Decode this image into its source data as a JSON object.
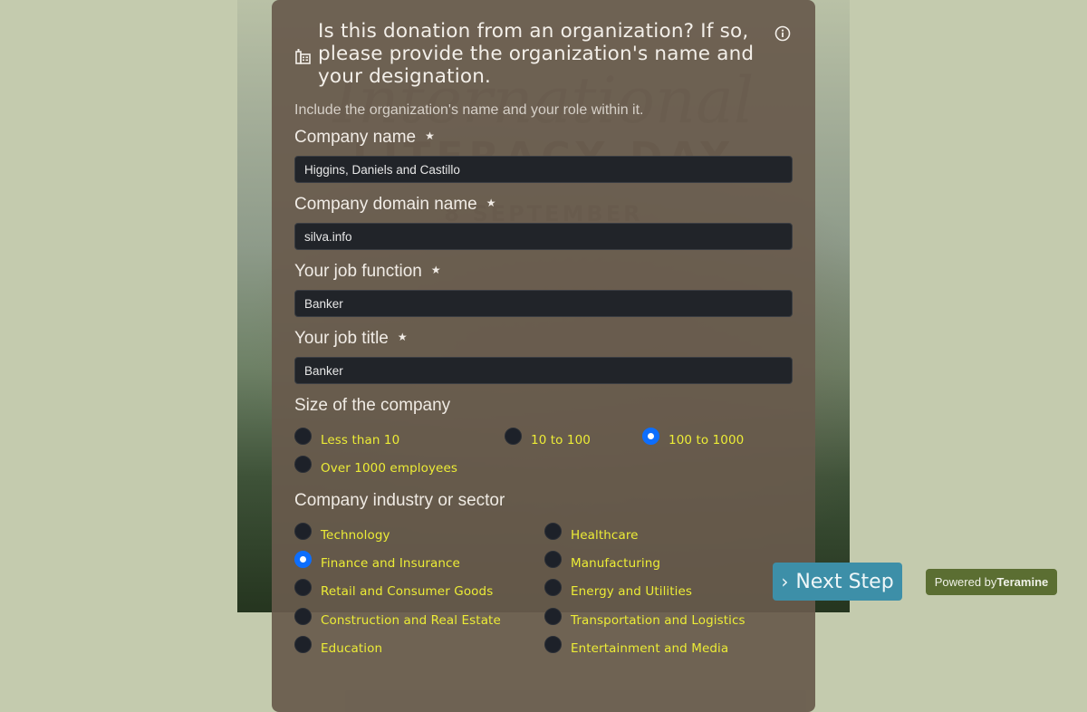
{
  "background": {
    "headline_script": "International",
    "headline": "LITERACY DAY",
    "date": "8 SEPTEMBER"
  },
  "form": {
    "title": "Is this donation from an organization? If so, please provide the organization's name and your designation.",
    "title_icon": "building-icon",
    "info_icon": "info-icon",
    "subtitle": "Include the organization's name and your role within it.",
    "required_marker": "★",
    "fields": {
      "company_name": {
        "label": "Company name",
        "value": "Higgins, Daniels and Castillo",
        "required": true
      },
      "company_domain": {
        "label": "Company domain name",
        "value": "silva.info",
        "required": true
      },
      "job_function": {
        "label": "Your job function",
        "value": "Banker",
        "required": true
      },
      "job_title": {
        "label": "Your job title",
        "value": "Banker",
        "required": true
      }
    },
    "company_size": {
      "label": "Size of the company",
      "options": [
        "Less than 10",
        "10 to 100",
        "100 to 1000",
        "Over 1000 employees"
      ],
      "selected": "100 to 1000"
    },
    "industry": {
      "label": "Company industry or sector",
      "options": [
        "Technology",
        "Healthcare",
        "Finance and Insurance",
        "Manufacturing",
        "Retail and Consumer Goods",
        "Energy and Utilities",
        "Construction and Real Estate",
        "Transportation and Logistics",
        "Education",
        "Entertainment and Media"
      ],
      "selected": "Finance and Insurance"
    }
  },
  "next_button": {
    "icon": "chevron-right-icon",
    "label": "Next Step"
  },
  "powered_by": {
    "prefix": "Powered by",
    "brand": "Teramine"
  },
  "colors": {
    "page_bg": "#c4cbae",
    "card_bg": "#685a4c",
    "input_bg": "#212429",
    "radio_label": "#ecec36",
    "radio_checked": "#0d6efd",
    "next_button": "#3d8fa8",
    "powered_badge": "#5b6e32"
  }
}
